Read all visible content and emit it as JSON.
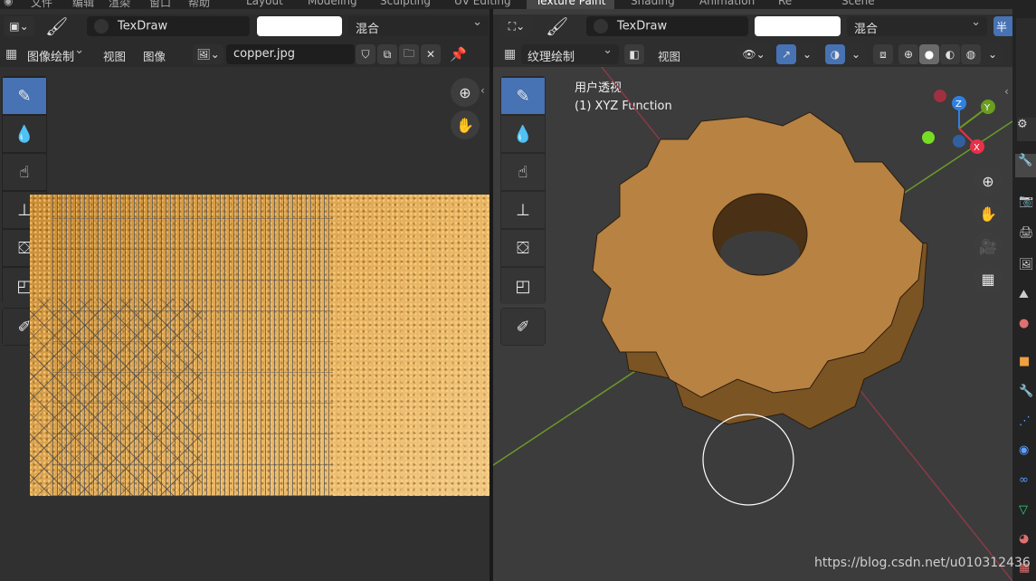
{
  "workspace_tabs": [
    "Layout",
    "Modeling",
    "Sculpting",
    "UV Editing",
    "Texture Paint",
    "Shading",
    "Animation",
    "Re"
  ],
  "active_tab": "Texture Paint",
  "top_menu_fragments": [
    "文件",
    "编辑",
    "渲染",
    "窗口",
    "帮助"
  ],
  "scene_label": "Scene",
  "left_editor": {
    "brush_name": "TexDraw",
    "blend_mode": "混合",
    "mode_dropdown": "图像绘制",
    "menus": [
      "视图",
      "图像"
    ],
    "image_name": "copper.jpg"
  },
  "right_editor": {
    "brush_name": "TexDraw",
    "blend_mode": "混合",
    "mode_dropdown": "纹理绘制",
    "menu_view": "视图",
    "overlay_line1": "用户透视",
    "overlay_line2": "(1) XYZ Function",
    "axis_z": "Z",
    "axis_y": "Y",
    "axis_x": "X",
    "half_label": "半"
  },
  "watermark": "https://blog.csdn.net/u010312436",
  "colors": {
    "accent": "#4772b3",
    "axis_x": "#e8304a",
    "axis_y": "#6a9e1e",
    "axis_z": "#2f80e0",
    "copper": "#d99a3e"
  }
}
